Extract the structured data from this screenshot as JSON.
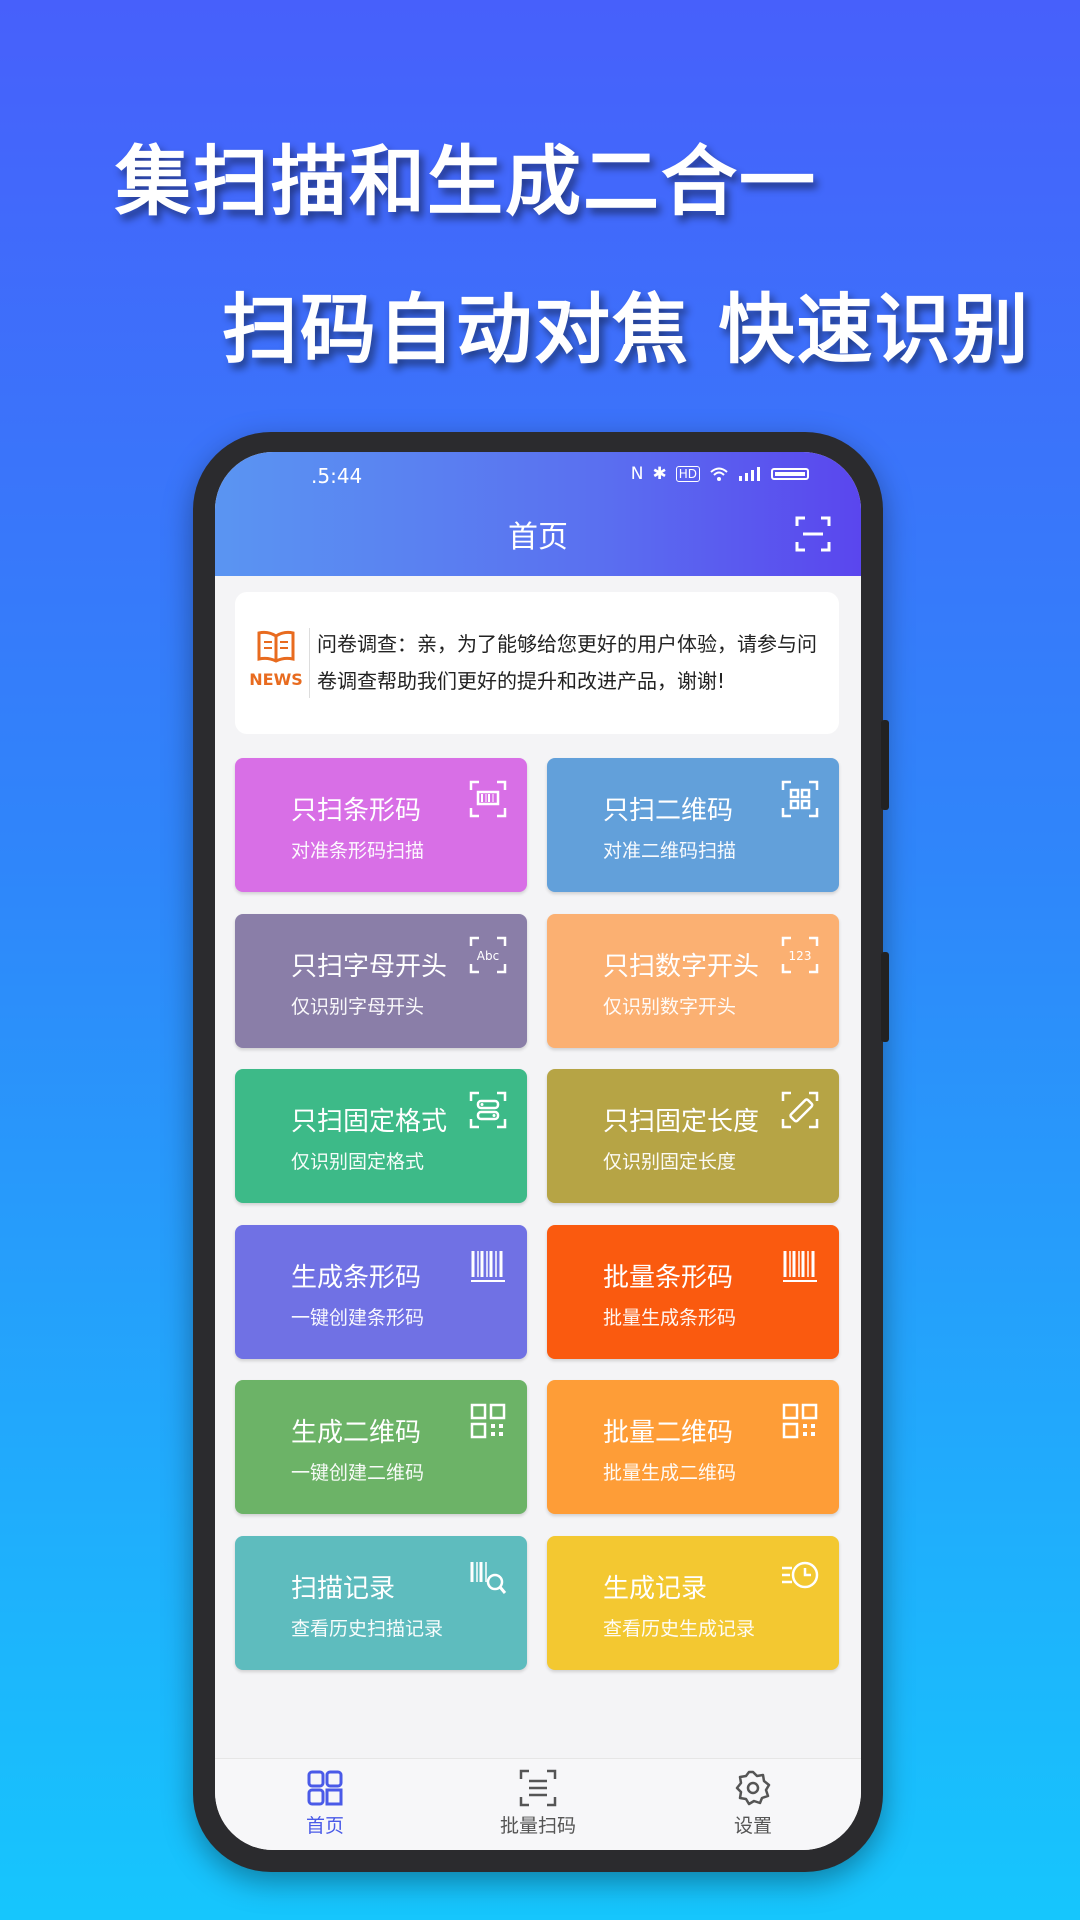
{
  "headline": {
    "line1": "集扫描和生成二合一",
    "line2": "扫码自动对焦 快速识别"
  },
  "status": {
    "time": ".5:44",
    "icons": [
      "nfc-icon",
      "bluetooth-icon",
      "hd-icon",
      "wifi-icon",
      "signal-icon",
      "battery-icon"
    ],
    "hd": "HD"
  },
  "header": {
    "title": "首页",
    "scan_icon": "scan-frame-icon"
  },
  "news": {
    "label": "NEWS",
    "text": "问卷调查：亲，为了能够给您更好的用户体验，请参与问卷调查帮助我们更好的提升和改进产品，谢谢!"
  },
  "cards": [
    {
      "title": "只扫条形码",
      "subtitle": "对准条形码扫描",
      "color": "#d86fe6",
      "icon": "scan-barcode-icon"
    },
    {
      "title": "只扫二维码",
      "subtitle": "对准二维码扫描",
      "color": "#62a0da",
      "icon": "scan-qrcode-icon"
    },
    {
      "title": "只扫字母开头",
      "subtitle": "仅识别字母开头",
      "color": "#8a7ea8",
      "icon": "abc-icon",
      "icon_text": "Abc"
    },
    {
      "title": "只扫数字开头",
      "subtitle": "仅识别数字开头",
      "color": "#fbb072",
      "icon": "123-icon",
      "icon_text": "123"
    },
    {
      "title": "只扫固定格式",
      "subtitle": "仅识别固定格式",
      "color": "#3dba88",
      "icon": "format-icon"
    },
    {
      "title": "只扫固定长度",
      "subtitle": "仅识别固定长度",
      "color": "#b6a445",
      "icon": "ruler-icon"
    },
    {
      "title": "生成条形码",
      "subtitle": "一键创建条形码",
      "color": "#7071e4",
      "icon": "barcode-icon"
    },
    {
      "title": "批量条形码",
      "subtitle": "批量生成条形码",
      "color": "#fa5a0f",
      "icon": "barcode-icon"
    },
    {
      "title": "生成二维码",
      "subtitle": "一键创建二维码",
      "color": "#6cb367",
      "icon": "qrcode-icon"
    },
    {
      "title": "批量二维码",
      "subtitle": "批量生成二维码",
      "color": "#fe9d37",
      "icon": "qrcode-icon"
    },
    {
      "title": "扫描记录",
      "subtitle": "查看历史扫描记录",
      "color": "#5ebcbe",
      "icon": "barcode-search-icon"
    },
    {
      "title": "生成记录",
      "subtitle": "查看历史生成记录",
      "color": "#f3c831",
      "icon": "history-clock-icon"
    }
  ],
  "nav": [
    {
      "label": "首页",
      "icon": "home-grid-icon",
      "active": true
    },
    {
      "label": "批量扫码",
      "icon": "batch-scan-icon",
      "active": false
    },
    {
      "label": "设置",
      "icon": "settings-gear-icon",
      "active": false
    }
  ]
}
